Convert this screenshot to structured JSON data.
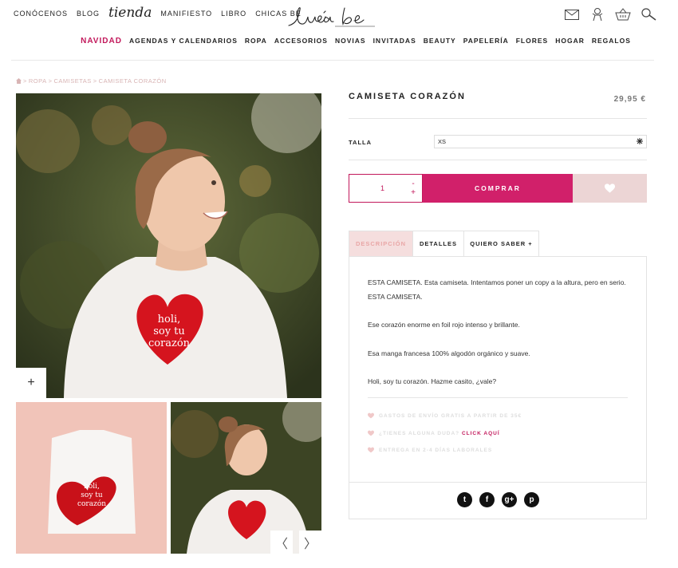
{
  "header": {
    "top_links": [
      "CONÓCENOS",
      "BLOG",
      "tienda",
      "MANIFIESTO",
      "LIBRO",
      "CHICAS BE"
    ],
    "logo_text": "Lucía be",
    "icons": [
      "mail-icon",
      "user-icon",
      "basket-icon",
      "search-icon"
    ]
  },
  "nav": {
    "items": [
      "NAVIDAD",
      "AGENDAS Y CALENDARIOS",
      "ROPA",
      "ACCESORIOS",
      "NOVIAS",
      "INVITADAS",
      "BEAUTY",
      "PAPELERÍA",
      "FLORES",
      "HOGAR",
      "REGALOS"
    ],
    "active": "NAVIDAD"
  },
  "breadcrumb": {
    "separator": ">",
    "items": [
      "ROPA",
      "CAMISETAS",
      "CAMISETA CORAZÓN"
    ]
  },
  "gallery": {
    "zoom_label": "+",
    "prev_label": "〈",
    "next_label": "〉",
    "shirt_print": [
      "holi,",
      "soy tu",
      "corazón"
    ]
  },
  "product": {
    "title": "CAMISETA CORAZÓN",
    "price": "29,95 €",
    "size_label": "TALLA",
    "size_value": "XS",
    "quantity": "1",
    "qty_minus": "-",
    "qty_plus": "+",
    "buy_label": "COMPRAR"
  },
  "tabs": [
    {
      "label": "DESCRIPCIÓN",
      "active": true
    },
    {
      "label": "DETALLES",
      "active": false
    },
    {
      "label": "QUIERO SABER +",
      "active": false
    }
  ],
  "description": [
    "ESTA CAMISETA. Esta camiseta. Intentamos poner un copy a la altura, pero en serio. ESTA CAMISETA.",
    "Ese corazón enorme en foil rojo intenso y brillante.",
    "Esa manga francesa 100% algodón orgánico y suave.",
    "Holi, soy tu corazón. Hazme casito, ¿vale?"
  ],
  "info": {
    "shipping": "GASTOS DE ENVÍO GRATIS A PARTIR DE 35€",
    "question": "¿TIENES ALGUNA DUDA?",
    "question_link": "CLICK AQUÍ",
    "delivery": "ENTREGA EN 2-4 DÍAS LABORALES"
  },
  "social": [
    {
      "name": "twitter-icon",
      "glyph": "t"
    },
    {
      "name": "facebook-icon",
      "glyph": "f"
    },
    {
      "name": "googleplus-icon",
      "glyph": "g+"
    },
    {
      "name": "pinterest-icon",
      "glyph": "p"
    }
  ],
  "colors": {
    "accent": "#d1206a",
    "wishlist_bg": "#ecd5d5",
    "tab_active_bg": "#f5dede"
  }
}
